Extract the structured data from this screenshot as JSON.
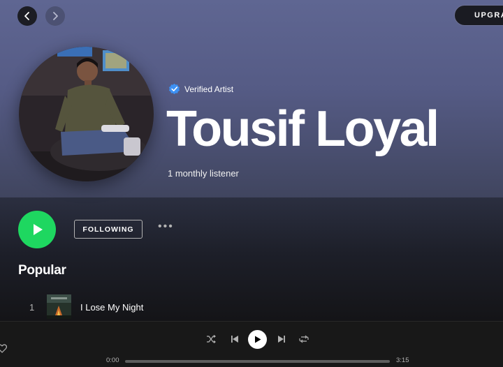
{
  "nav": {
    "back_icon": "chevron-left-icon",
    "forward_icon": "chevron-right-icon"
  },
  "header": {
    "upgrade_label": "UPGRADE"
  },
  "artist": {
    "verified_label": "Verified Artist",
    "name": "Tousif Loyal",
    "monthly_listeners": "1 monthly listener"
  },
  "actions": {
    "follow_label": "FOLLOWING",
    "more_label": "•••"
  },
  "popular": {
    "title": "Popular",
    "tracks": [
      {
        "number": "1",
        "title": "I Lose My Night"
      }
    ]
  },
  "player": {
    "current_time": "0:00",
    "total_time": "3:15",
    "progress": 0.0
  },
  "colors": {
    "accent": "#1ed760",
    "hero_top": "#5f6692",
    "verified": "#3d91f4"
  }
}
